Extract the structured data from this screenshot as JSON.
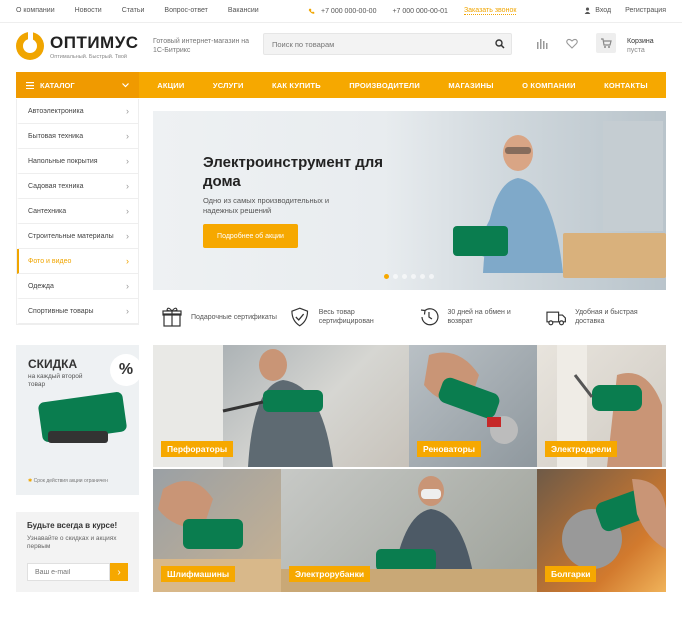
{
  "topbar": {
    "links": [
      "О компании",
      "Новости",
      "Статьи",
      "Вопрос-ответ",
      "Вакансии"
    ],
    "phones": [
      "+7 000 000-00-00",
      "+7 000 000-00-01"
    ],
    "callback": "Заказать звонок",
    "login": "Вход",
    "register": "Регистрация"
  },
  "header": {
    "logo": "ОПТИМУС",
    "logo_sub": "Оптимальный. Быстрый. Твой",
    "tagline": "Готовый интернет-магазин на 1С-Битрикс",
    "search_placeholder": "Поиск по товарам",
    "cart_title": "Корзина",
    "cart_status": "пуста"
  },
  "nav": {
    "catalog": "КАТАЛОГ",
    "items": [
      "АКЦИИ",
      "УСЛУГИ",
      "КАК КУПИТЬ",
      "ПРОИЗВОДИТЕЛИ",
      "МАГАЗИНЫ",
      "О КОМПАНИИ",
      "КОНТАКТЫ"
    ]
  },
  "sidebar": {
    "items": [
      "Автоэлектроника",
      "Бытовая техника",
      "Напольные покрытия",
      "Садовая техника",
      "Сантехника",
      "Строительные материалы",
      "Фото и видео",
      "Одежда",
      "Спортивные товары"
    ],
    "active_index": 6
  },
  "banner": {
    "title": "Электроинструмент для дома",
    "desc": "Одно из самых производительных и надежных решений",
    "button": "Подробнее об акции",
    "slides": 6,
    "active_slide": 0
  },
  "features": [
    {
      "icon": "gift-icon",
      "text": "Подарочные сертификаты"
    },
    {
      "icon": "shield-check-icon",
      "text": "Весь товар сертифицирован"
    },
    {
      "icon": "clock-return-icon",
      "text": "30 дней на обмен и возврат"
    },
    {
      "icon": "truck-icon",
      "text": "Удобная и быстрая доставка"
    }
  ],
  "promo": {
    "title": "СКИДКА",
    "subtitle": "на каждый второй товар",
    "percent": "%",
    "footnote": "Срок действия акции ограничен"
  },
  "subscribe": {
    "title": "Будьте всегда в курсе!",
    "desc": "Узнавайте о скидках и акциях первым",
    "placeholder": "Ваш e-mail"
  },
  "tiles": [
    "Перфораторы",
    "Реноваторы",
    "Электродрели",
    "Шлифмашины",
    "Электрорубанки",
    "Болгарки"
  ],
  "colors": {
    "accent": "#f6a800",
    "accent_dark": "#f09a00",
    "tool_green": "#0a7d4f"
  }
}
